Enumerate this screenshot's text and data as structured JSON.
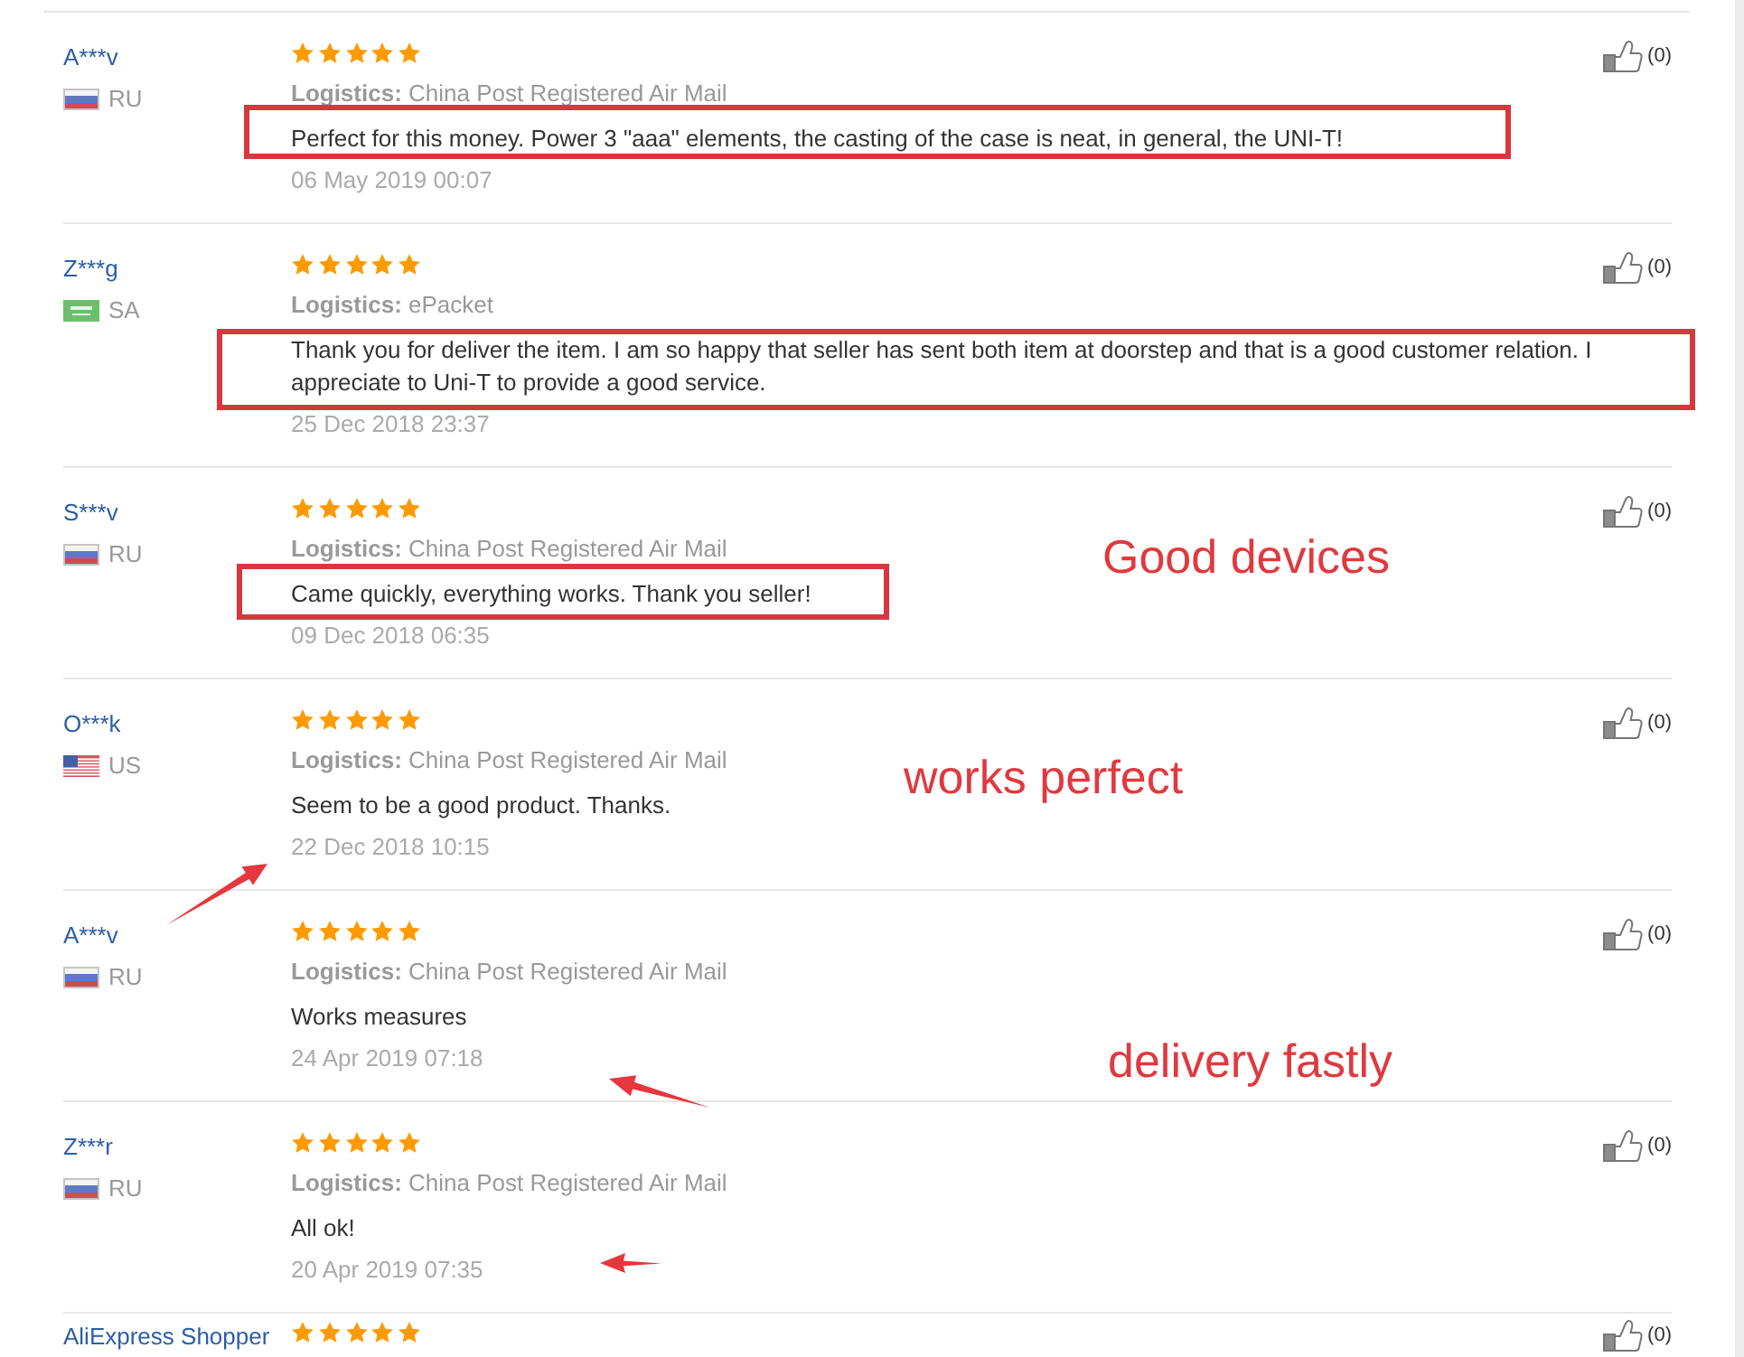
{
  "reviews": [
    {
      "reviewer": "A***v",
      "country": {
        "kind": "ru",
        "code": "RU"
      },
      "stars": 5,
      "logistics": "**Logistics:** China Post Registered Air Mail",
      "comment": "Perfect for this money. Power 3 \"aaa\" elements, the casting of the case is neat, in general, the UNI-T!",
      "date": "06 May 2019 00:07",
      "likes": "(0)",
      "highlighted": true,
      "arrow": false
    },
    {
      "reviewer": "Z***g",
      "country": {
        "kind": "sa",
        "code": "SA"
      },
      "stars": 5,
      "logistics": "**Logistics:** ePacket",
      "comment": "Thank you for deliver the item. I am so happy that seller has sent both item at doorstep and that is a good customer relation. I appreciate to Uni-T to provide a good service.",
      "date": "25 Dec 2018 23:37",
      "likes": "(0)",
      "highlighted": true,
      "arrow": false
    },
    {
      "reviewer": "S***v",
      "country": {
        "kind": "ru",
        "code": "RU"
      },
      "stars": 5,
      "logistics": "**Logistics:** China Post Registered Air Mail",
      "comment": "Came quickly, everything works. Thank you seller!",
      "date": "09 Dec 2018 06:35",
      "likes": "(0)",
      "highlighted": true,
      "arrow": false,
      "note": "Good devices"
    },
    {
      "reviewer": "O***k",
      "country": {
        "kind": "us",
        "code": "US"
      },
      "stars": 5,
      "logistics": "**Logistics:** China Post Registered Air Mail",
      "comment": "Seem to be a good product. Thanks.",
      "date": "22 Dec 2018 10:15",
      "likes": "(0)",
      "highlighted": false,
      "arrow": true,
      "note": "works perfect"
    },
    {
      "reviewer": "A***v",
      "country": {
        "kind": "ru",
        "code": "RU"
      },
      "stars": 5,
      "logistics": "**Logistics:** China Post Registered Air Mail",
      "comment": "Works measures",
      "date": "24 Apr 2019 07:18",
      "likes": "(0)",
      "highlighted": false,
      "arrow": true,
      "note": "delivery fastly"
    },
    {
      "reviewer": "Z***r",
      "country": {
        "kind": "ru",
        "code": "RU"
      },
      "stars": 5,
      "logistics": "**Logistics:** China Post Registered Air Mail",
      "comment": "All ok!",
      "date": "20 Apr 2019 07:35",
      "likes": "(0)",
      "highlighted": false,
      "arrow": true
    },
    {
      "reviewer": "AliExpress Shopper",
      "stars": 5,
      "likes": "(0)",
      "highlighted": false,
      "arrow": false
    }
  ]
}
